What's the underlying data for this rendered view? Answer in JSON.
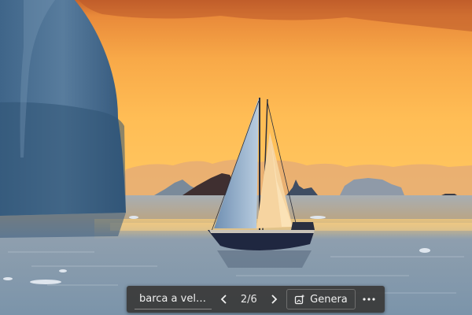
{
  "image": {
    "subject": "sailboat-among-icebergs-at-sunset"
  },
  "toolbar": {
    "search_text": "barca a vela bi...",
    "counter": "2/6",
    "genera_label": "Genera",
    "icons": {
      "prev": "chevron-left-icon",
      "next": "chevron-right-icon",
      "genera": "image-sparkle-icon",
      "more": "more-horizontal-icon"
    }
  },
  "colors": {
    "sky_top": "#f2a24a",
    "sky_bottom": "#ffc25c",
    "sea": "#8ea3b5",
    "iceberg": "#4d6f8f",
    "toolbar_bg": "#3a3a3a",
    "toolbar_text": "#e8e8e8"
  }
}
